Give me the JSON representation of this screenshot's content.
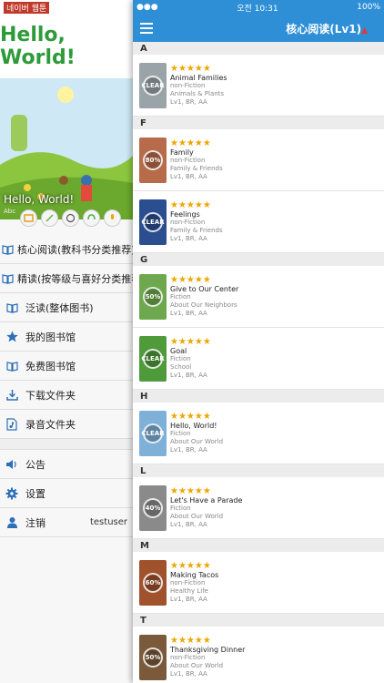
{
  "left": {
    "status_badge": "네이버 웹툰",
    "title": "Hello, World!",
    "overlay_title": "Hello, World!",
    "overlay_sub": "Abc",
    "menu": [
      {
        "label": "核心阅读(教科书分类推荐)",
        "icon": "book-open-icon"
      },
      {
        "label": "精读(按等级与喜好分类推荐)",
        "icon": "book-open-icon"
      },
      {
        "label": "泛读(整体图书)",
        "icon": "book-open-icon"
      },
      {
        "label": "我的图书馆",
        "icon": "star-icon"
      },
      {
        "label": "免费图书馆",
        "icon": "book-open-icon"
      },
      {
        "label": "下载文件夹",
        "icon": "download-icon"
      },
      {
        "label": "录音文件夹",
        "icon": "audio-file-icon"
      }
    ],
    "menu2": [
      {
        "label": "公告",
        "icon": "speaker-icon"
      },
      {
        "label": "设置",
        "icon": "gear-icon"
      },
      {
        "label": "注销",
        "icon": "user-icon",
        "extra": "testuser"
      }
    ]
  },
  "right": {
    "status_time": "오전 10:31",
    "status_battery": "100%",
    "title": "核心阅读(Lv1)",
    "sections": [
      {
        "letter": "A",
        "books": [
          {
            "title": "Animal Families",
            "type": "non-Fiction",
            "topic": "Animals & Plants",
            "level": "Lv1,  BR,  AA",
            "cover_color": "#9aa3a8",
            "badge": "CLEAR"
          }
        ]
      },
      {
        "letter": "F",
        "books": [
          {
            "title": "Family",
            "type": "non-Fiction",
            "topic": "Family & Friends",
            "level": "Lv1,  BR,  AA",
            "cover_color": "#b86b4a",
            "badge": "80%"
          },
          {
            "title": "Feelings",
            "type": "non-Fiction",
            "topic": "Family & Friends",
            "level": "Lv1,  BR,  AA",
            "cover_color": "#2a4e8f",
            "badge": "CLEAR"
          }
        ]
      },
      {
        "letter": "G",
        "books": [
          {
            "title": "Give to Our Center",
            "type": "Fiction",
            "topic": "About Our Neighbors",
            "level": "Lv1,  BR,  AA",
            "cover_color": "#6ea84e",
            "badge": "50%"
          },
          {
            "title": "Goal",
            "type": "Fiction",
            "topic": "School",
            "level": "Lv1,  BR,  AA",
            "cover_color": "#4f9a3a",
            "badge": "CLEAR"
          }
        ]
      },
      {
        "letter": "H",
        "books": [
          {
            "title": "Hello, World!",
            "type": "Fiction",
            "topic": "About Our World",
            "level": "Lv1,  BR,  AA",
            "cover_color": "#7fb0d8",
            "badge": "CLEAR"
          }
        ]
      },
      {
        "letter": "L",
        "books": [
          {
            "title": "Let's Have a Parade",
            "type": "Fiction",
            "topic": "About Our World",
            "level": "Lv1,  BR,  AA",
            "cover_color": "#8a8a8a",
            "badge": "40%"
          }
        ]
      },
      {
        "letter": "M",
        "books": [
          {
            "title": "Making Tacos",
            "type": "non-Fiction",
            "topic": "Healthy Life",
            "level": "Lv1,  BR,  AA",
            "cover_color": "#a0522d",
            "badge": "60%"
          }
        ]
      },
      {
        "letter": "T",
        "books": [
          {
            "title": "Thanksgiving Dinner",
            "type": "non-Fiction",
            "topic": "About Our World",
            "level": "Lv1,  BR,  AA",
            "cover_color": "#7a5a3a",
            "badge": "50%"
          }
        ]
      }
    ],
    "stars": "★★★★★"
  }
}
